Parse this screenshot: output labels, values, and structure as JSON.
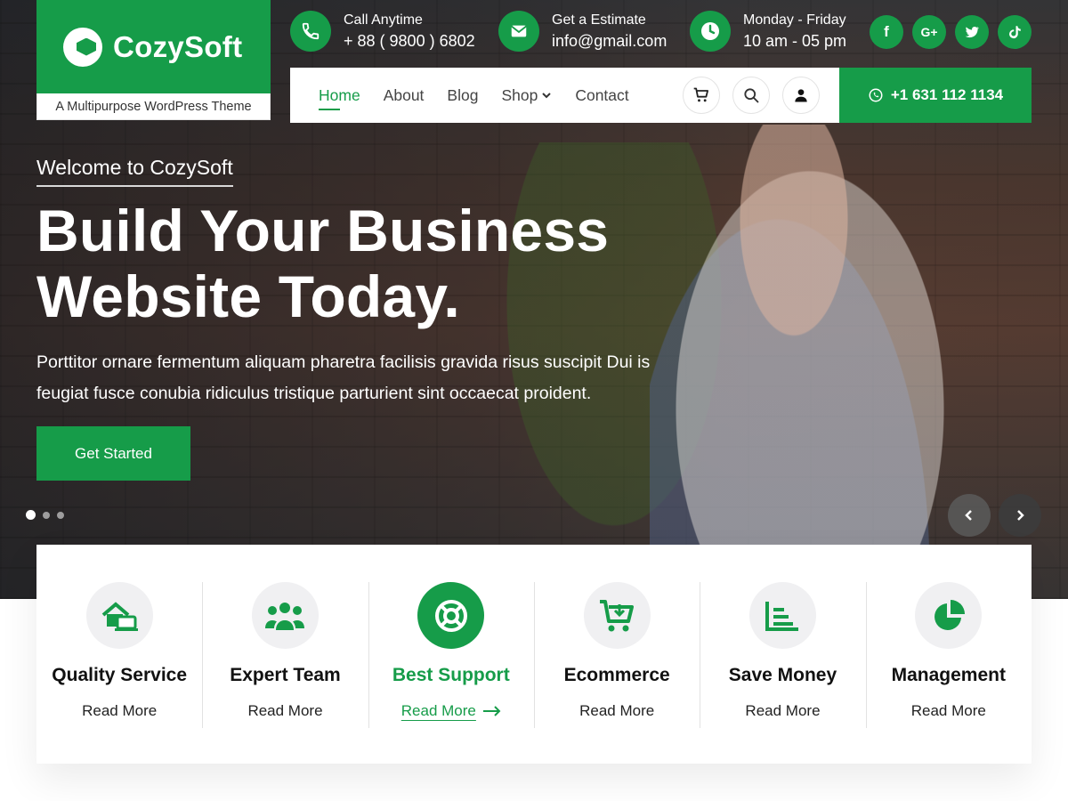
{
  "brand": {
    "name": "CozySoft",
    "tagline": "A Multipurpose WordPress Theme"
  },
  "topbar": {
    "contacts": [
      {
        "icon": "phone-icon",
        "label": "Call Anytime",
        "value": "+ 88 ( 9800 ) 6802"
      },
      {
        "icon": "envelope-icon",
        "label": "Get a Estimate",
        "value": "info@gmail.com"
      },
      {
        "icon": "clock-icon",
        "label": "Monday - Friday",
        "value": "10 am - 05 pm"
      }
    ],
    "socials": [
      {
        "icon": "facebook-icon",
        "glyph": "f"
      },
      {
        "icon": "google-plus-icon",
        "glyph": "G+"
      },
      {
        "icon": "twitter-icon",
        "glyph": "t"
      },
      {
        "icon": "tiktok-icon",
        "glyph": "d"
      }
    ]
  },
  "nav": {
    "items": [
      "Home",
      "About",
      "Blog",
      "Shop",
      "Contact"
    ],
    "active": "Home",
    "phone": "+1 631 112 1134"
  },
  "hero": {
    "welcome": "Welcome to CozySoft",
    "headline_line1": "Build Your Business",
    "headline_line2": "Website Today.",
    "description_line1": "Porttitor ornare fermentum aliquam pharetra facilisis gravida risus suscipit Dui is",
    "description_line2": "feugiat fusce conubia ridiculus tristique parturient sint occaecat proident.",
    "cta": "Get Started",
    "slide_count": 3,
    "active_slide": 1
  },
  "features": [
    {
      "title": "Quality Service",
      "link": "Read More",
      "icon": "home-devices-icon"
    },
    {
      "title": "Expert Team",
      "link": "Read More",
      "icon": "team-icon"
    },
    {
      "title": "Best Support",
      "link": "Read More",
      "icon": "lifebuoy-icon",
      "active": true
    },
    {
      "title": "Ecommerce",
      "link": "Read More",
      "icon": "cart-download-icon"
    },
    {
      "title": "Save Money",
      "link": "Read More",
      "icon": "bar-chart-icon"
    },
    {
      "title": "Management",
      "link": "Read More",
      "icon": "pie-chart-icon"
    }
  ],
  "colors": {
    "accent": "#169c49"
  }
}
